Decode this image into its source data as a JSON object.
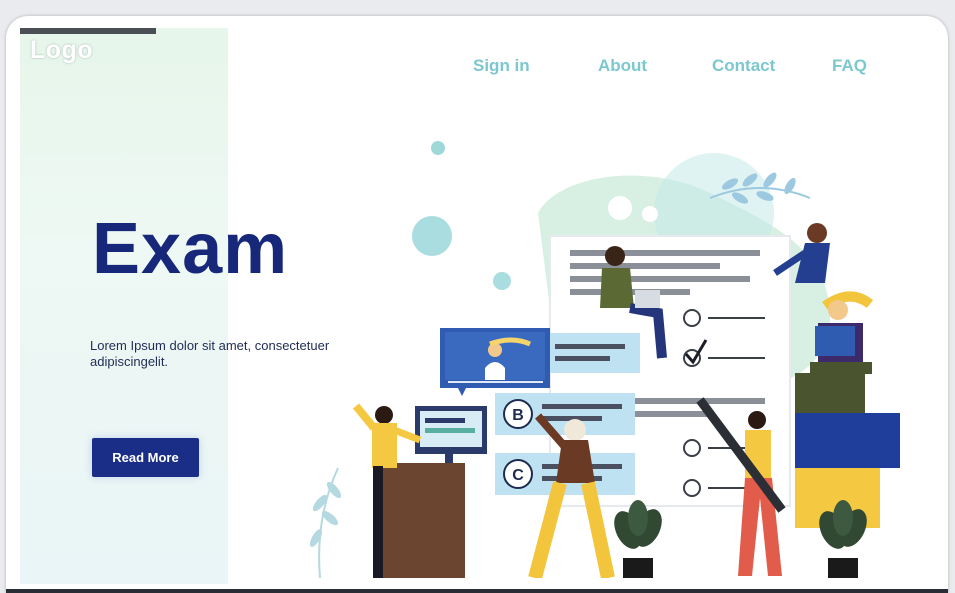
{
  "logo": {
    "text": "Logo"
  },
  "nav": {
    "items": [
      {
        "label": "Sign in"
      },
      {
        "label": "About"
      },
      {
        "label": "Contact"
      },
      {
        "label": "FAQ"
      }
    ]
  },
  "hero": {
    "title": "Exam",
    "description": "Lorem Ipsum dolor sit amet, consectetuer adipiscingelit.",
    "cta_label": "Read More"
  },
  "illustration": {
    "answer_markers": [
      "B",
      "C"
    ]
  },
  "colors": {
    "title": "#17277a",
    "button": "#1a2e87",
    "nav_text": "#7cc8cf",
    "panel_bg": "#e6f6ea"
  }
}
